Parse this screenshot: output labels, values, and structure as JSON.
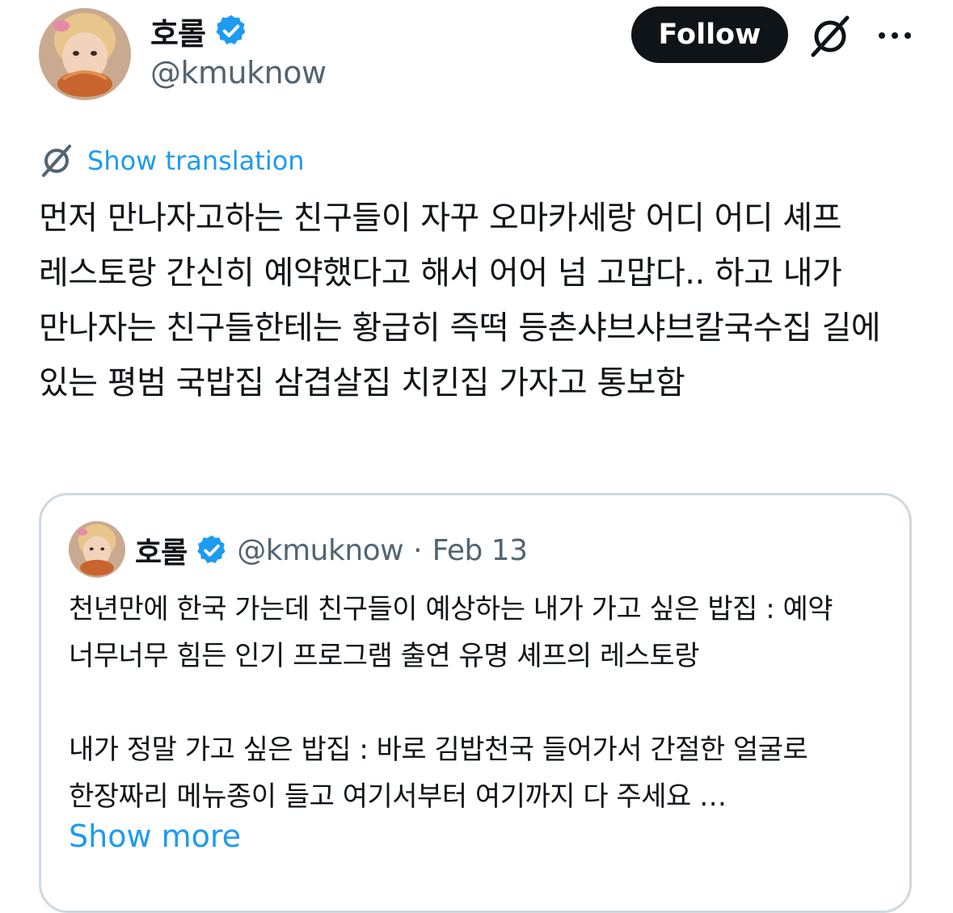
{
  "author": {
    "display_name": "호롤",
    "handle": "@kmuknow",
    "verified": true
  },
  "actions": {
    "follow_label": "Follow",
    "grok_icon": "grok-icon",
    "more_icon": "more-icon"
  },
  "translate": {
    "label": "Show translation",
    "icon": "grok-icon"
  },
  "tweet": {
    "text": "먼저 만나자고하는 친구들이 자꾸 오마카세랑 어디 어디 셰프 레스토랑 간신히 예약했다고 해서 어어 넘 고맙다.. 하고 내가 만나자는 친구들한테는 황급히 즉떡 등촌샤브샤브칼국수집 길에 있는 평범 국밥집 삼겹살집 치킨집 가자고 통보함"
  },
  "quote": {
    "display_name": "호롤",
    "handle": "@kmuknow",
    "separator": "·",
    "date": "Feb 13",
    "text": "천년만에 한국 가는데 친구들이 예상하는 내가 가고 싶은 밥집 : 예약 너무너무 힘든 인기 프로그램 출연 유명 셰프의 레스토랑\n\n내가 정말 가고 싶은 밥집 : 바로 김밥천국 들어가서 간절한 얼굴로 한장짜리 메뉴종이 들고 여기서부터 여기까지 다 주세요 …",
    "show_more": "Show more"
  },
  "colors": {
    "accent": "#1d9bf0",
    "text": "#0f1419",
    "secondary": "#536471",
    "border": "#cfd9de",
    "button_bg": "#0f1419"
  }
}
